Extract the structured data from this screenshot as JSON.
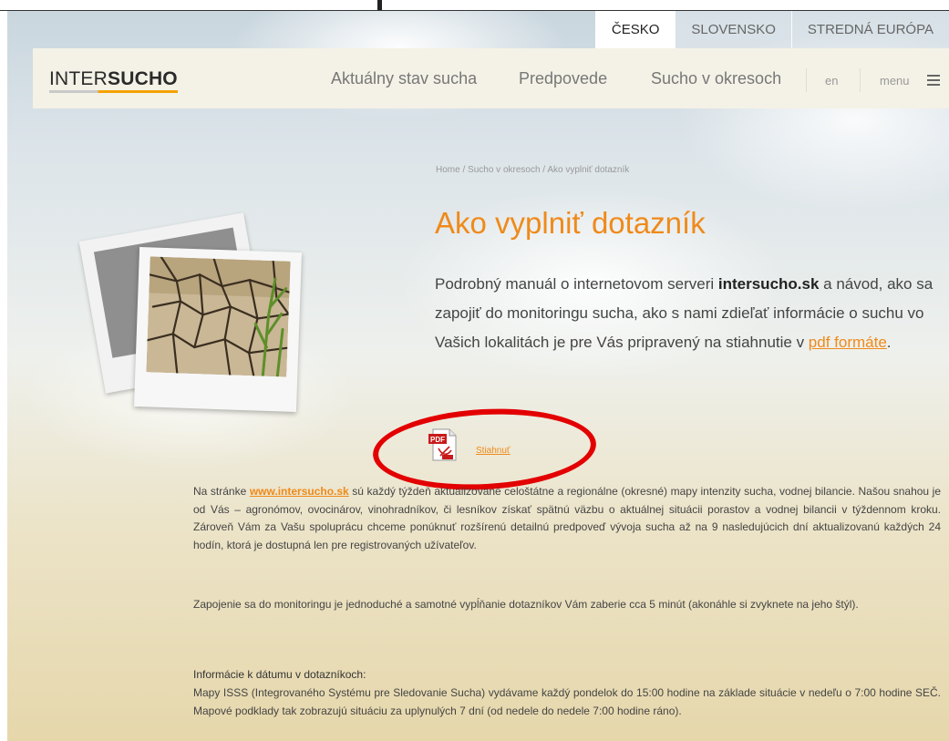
{
  "region_tabs": [
    "ČESKO",
    "SLOVENSKO",
    "STREDNÁ EURÓPA"
  ],
  "logo": {
    "part1": "INTER",
    "part2": "SUCHO"
  },
  "nav": {
    "items": [
      "Aktuálny stav sucha",
      "Predpovede",
      "Sucho v okresoch"
    ],
    "lang": "en",
    "menu": "menu"
  },
  "breadcrumb": {
    "home": "Home",
    "sep": " / ",
    "section": "Sucho v okresoch",
    "current": "Ako vyplniť dotazník"
  },
  "title": "Ako vyplniť dotazník",
  "intro": {
    "before": " Podrobný manuál o internetovom serveri ",
    "bold": "intersucho.sk",
    "after": " a návod, ako sa zapojiť do monitoringu sucha, ako s nami zdieľať informácie o suchu vo Vašich lokalitách je pre Vás pripravený na stiahnutie v ",
    "link": "pdf formáte",
    "end": "."
  },
  "download": {
    "label": "Stiahnuť",
    "icon": "pdf-icon"
  },
  "paragraph1": {
    "before": "Na stránke ",
    "link": "www.intersucho.sk",
    "after": " sú každý týždeň aktualizované celoštátne a regionálne (okresné) mapy intenzity sucha, vodnej bilancie. Našou snahou je od Vás – agronómov, ovocinárov, vinohradníkov, či lesníkov získať spätnú väzbu o aktuálnej situácii porastov a vodnej bilancii v týždennom kroku. Zároveň Vám za Vašu spoluprácu chceme ponúknuť rozšírenú detailnú predpoveď vývoja sucha až na 9 nasledujúcich dní aktualizovanú každých 24 hodín, ktorá je dostupná len pre registrovaných užívateľov."
  },
  "paragraph2": "Zapojenie sa do monitoringu je jednoduché a samotné vypĺňanie dotazníkov Vám zaberie cca 5 minút (akonáhle si zvyknete na jeho štýl).",
  "info_heading": "Informácie k dátumu v dotazníkoch:",
  "paragraph3": "Mapy ISSS (Integrovaného Systému pre Sledovanie Sucha) vydávame každý pondelok do 15:00 hodine na základe situácie v nedeľu o 7:00 hodine SEČ. Mapové podklady tak zobrazujú situáciu za uplynulých 7 dní (od nedele do nedele 7:00 hodine ráno).",
  "colors": {
    "accent": "#ef8a1a",
    "annotation": "#e30000"
  }
}
